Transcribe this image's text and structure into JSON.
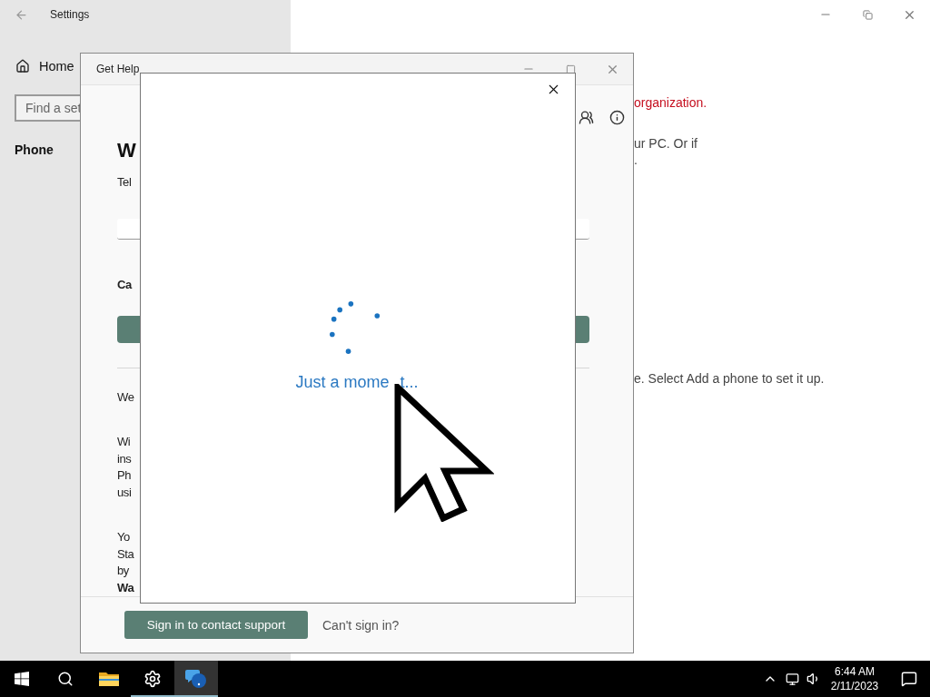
{
  "settings_window": {
    "title": "Settings",
    "nav": {
      "home": "Home",
      "search_placeholder": "Find a set",
      "section": "Phone"
    },
    "content": [
      {
        "kind": "warning",
        "lines": [
          "organization."
        ]
      },
      {
        "kind": "text",
        "lines": [
          "ur PC. Or if",
          "."
        ]
      },
      {
        "kind": "text",
        "lines": [
          "e. Select Add a phone to set it up."
        ]
      }
    ]
  },
  "get_help_window": {
    "title": "Get Help",
    "content": [
      {
        "kind": "heading",
        "text": "W"
      },
      {
        "kind": "text",
        "text": "Tel"
      },
      {
        "kind": "field"
      },
      {
        "kind": "label",
        "text": "Ca"
      },
      {
        "kind": "button"
      },
      {
        "kind": "divider"
      },
      {
        "kind": "text",
        "text": "We"
      },
      {
        "kind": "paragraph",
        "lines": [
          "Wi",
          "ins",
          "Ph",
          "usi"
        ]
      },
      {
        "kind": "paragraph",
        "lines": [
          "Yo",
          "Sta",
          "by",
          "**Wa**"
        ]
      }
    ],
    "footer": {
      "button": "Sign in to contact support",
      "link": "Can't sign in?"
    }
  },
  "dialog": {
    "loading_text_parts": [
      "Just a mome",
      "t..."
    ]
  },
  "taskbar": {
    "apps": [
      {
        "kind": "start",
        "running": false,
        "selected": false
      },
      {
        "kind": "search",
        "running": false,
        "selected": false
      },
      {
        "kind": "explorer",
        "running": false,
        "selected": false
      },
      {
        "kind": "settings",
        "running": true,
        "selected": false
      },
      {
        "kind": "help",
        "running": true,
        "selected": true
      }
    ],
    "clock": {
      "time": "6:44 AM",
      "date": "2/11/2023"
    }
  }
}
